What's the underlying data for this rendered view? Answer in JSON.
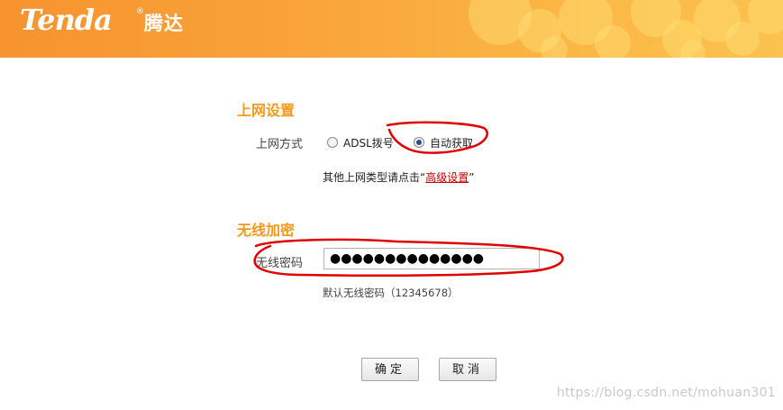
{
  "header": {
    "logo_text": "Tenda",
    "logo_reg": "®",
    "logo_cn": "腾达"
  },
  "internet": {
    "title": "上网设置",
    "mode_label": "上网方式",
    "options": [
      {
        "label": "ADSL拨号",
        "checked": false
      },
      {
        "label": "自动获取",
        "checked": true
      }
    ],
    "hint_prefix": "其他上网类型请点击“",
    "hint_link": "高级设置",
    "hint_suffix": "”"
  },
  "wireless": {
    "title": "无线加密",
    "password_label": "无线密码",
    "password_value": "●●●●●●●●●●●●●●",
    "default_hint": "默认无线密码（12345678）"
  },
  "actions": {
    "ok": "确定",
    "cancel": "取消"
  },
  "watermark": "https://blog.csdn.net/mohuan301",
  "colors": {
    "header_orange": "#f7932e",
    "section_title": "#f39a1d",
    "link": "#c80000",
    "annotation": "#e00000"
  }
}
